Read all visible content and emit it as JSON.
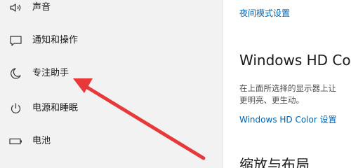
{
  "sidebar": {
    "items": [
      {
        "label": "声音",
        "icon": "speaker-icon"
      },
      {
        "label": "通知和操作",
        "icon": "notification-icon"
      },
      {
        "label": "专注助手",
        "icon": "moon-icon"
      },
      {
        "label": "电源和睡眠",
        "icon": "power-icon"
      },
      {
        "label": "电池",
        "icon": "battery-icon"
      }
    ]
  },
  "main": {
    "night_light_link": "夜间模式设置",
    "hd_color_heading": "Windows HD Color",
    "hd_color_desc_line1": "在上面所选择的显示器上让",
    "hd_color_desc_line2": "更明亮、更生动。",
    "hd_color_link": "Windows HD Color 设置",
    "scale_heading": "缩放与布局"
  },
  "colors": {
    "sidebar_bg": "#f2f2f2",
    "link": "#0063b1",
    "arrow": "#e8393a"
  }
}
